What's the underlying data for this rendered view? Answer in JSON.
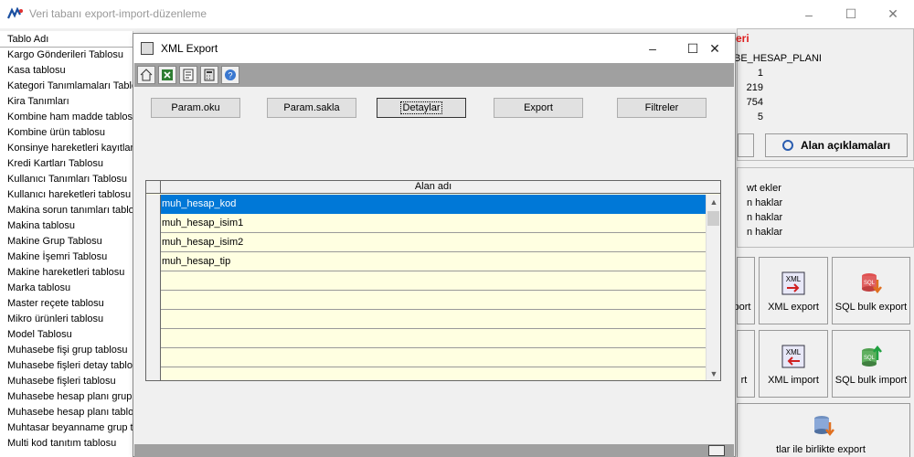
{
  "main_window": {
    "title": "Veri tabanı export-import-düzenleme",
    "minimize": "–",
    "maximize": "☐",
    "close": "✕"
  },
  "table_list": {
    "header": "Tablo Adı",
    "rows": [
      "Kargo Gönderileri Tablosu",
      "Kasa tablosu",
      "Kategori Tanımlamaları Tablosu",
      "Kira Tanımları",
      "Kombine ham madde tablosu",
      "Kombine ürün tablosu",
      "Konsinye hareketleri kayıtları",
      "Kredi Kartları Tablosu",
      "Kullanıcı Tanımları Tablosu",
      "Kullanıcı hareketleri tablosu",
      "Makina sorun tanımları tablosu",
      "Makina tablosu",
      "Makine Grup Tablosu",
      "Makine İşemri Tablosu",
      "Makine hareketleri tablosu",
      "Marka tablosu",
      "Master reçete tablosu",
      "Mikro ürünleri tablosu",
      "Model Tablosu",
      "Muhasebe fişi grup tablosu",
      "Muhasebe fişleri detay tablosu",
      "Muhasebe fişleri tablosu",
      "Muhasebe hesap planı grup tablosu",
      "Muhasebe hesap planı tablosu",
      "Muhtasar beyanname grup tablosu",
      "Multi kod tanıtım tablosu"
    ]
  },
  "right_panel": {
    "header_text": "eri",
    "table_name": "BE_HESAP_PLANI",
    "stats": [
      "1",
      "219",
      "754",
      "5"
    ],
    "field_desc_button": "Alan açıklamaları",
    "options": [
      "wt ekler",
      "n haklar",
      "n haklar",
      "n haklar"
    ],
    "export_partial": "port",
    "import_partial": "rt",
    "xml_export": "XML export",
    "sql_bulk_export": "SQL bulk export",
    "xml_import": "XML import",
    "sql_bulk_import": "SQL bulk import",
    "bottom_export": "tlar ile birlikte export"
  },
  "dialog": {
    "title": "XML Export",
    "minimize": "–",
    "maximize": "☐",
    "close": "✕",
    "buttons": {
      "param_oku": "Param.oku",
      "param_sakla": "Param.sakla",
      "detaylar": "Detaylar",
      "export": "Export",
      "filtreler": "Filtreler"
    },
    "grid": {
      "column": "Alan adı",
      "rows": [
        "muh_hesap_kod",
        "muh_hesap_isim1",
        "muh_hesap_isim2",
        "muh_hesap_tip",
        "",
        "",
        "",
        "",
        "",
        ""
      ]
    }
  },
  "colors": {
    "selection": "#0078d7",
    "grid_background": "#ffffe1",
    "accent_red": "#e02020"
  }
}
